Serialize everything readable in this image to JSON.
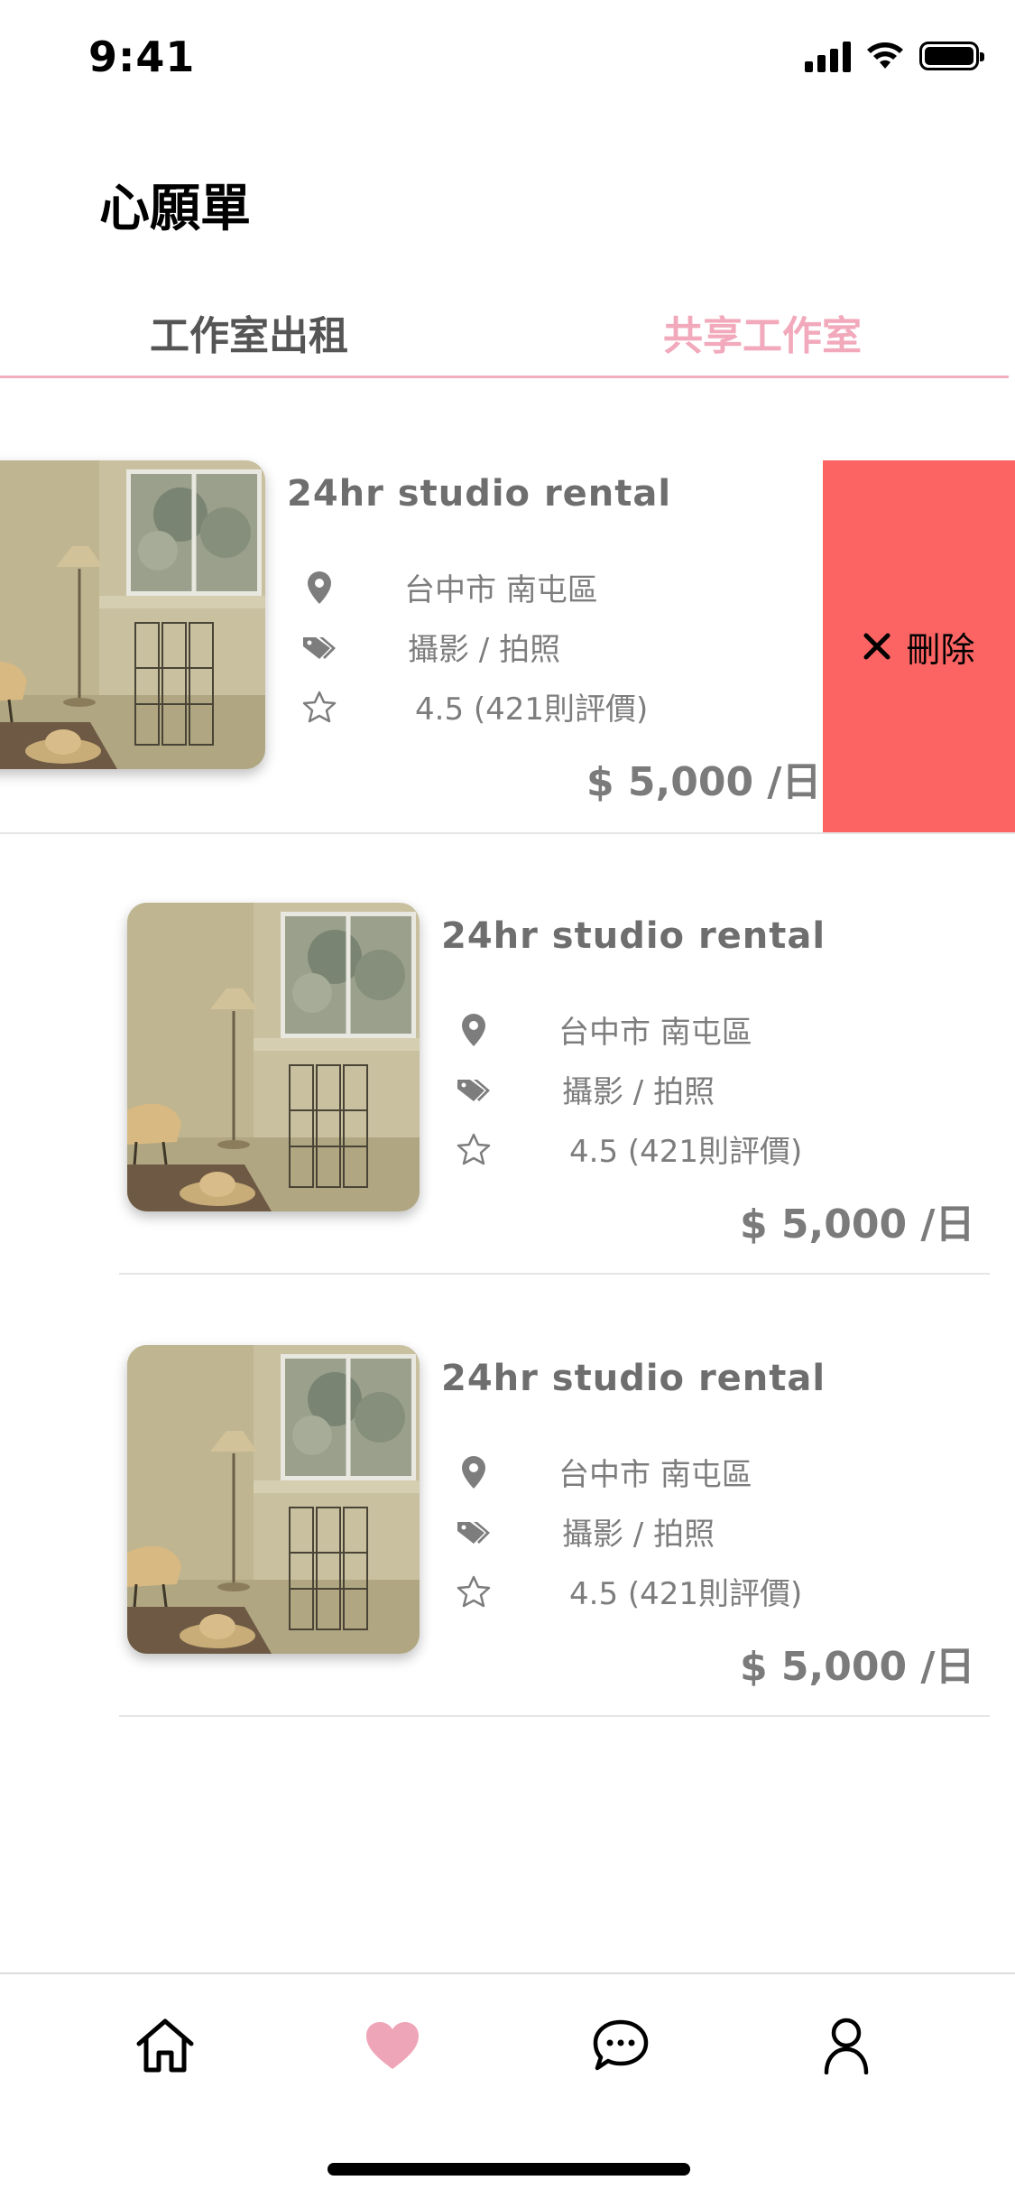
{
  "status_bar": {
    "time": "9:41"
  },
  "header": {
    "title": "心願單"
  },
  "tabs": [
    {
      "label": "工作室出租",
      "active": false
    },
    {
      "label": "共享工作室",
      "active": true
    }
  ],
  "listings": [
    {
      "title": "24hr studio rental",
      "location": "台中市 南屯區",
      "category": "攝影 / 拍照",
      "rating": "4.5 (421則評價)",
      "price": "$ 5,000 /日"
    },
    {
      "title": "24hr studio rental",
      "location": "台中市 南屯區",
      "category": "攝影 / 拍照",
      "rating": "4.5 (421則評價)",
      "price": "$ 5,000 /日"
    },
    {
      "title": "24hr studio rental",
      "location": "台中市 南屯區",
      "category": "攝影 / 拍照",
      "rating": "4.5 (421則評價)",
      "price": "$ 5,000 /日"
    }
  ],
  "swipe_action": {
    "label": "刪除",
    "icon": "close-icon",
    "color": "#fc6464"
  },
  "bottom_nav": [
    {
      "name": "home",
      "icon": "home-icon",
      "active": false
    },
    {
      "name": "wishlist",
      "icon": "heart-icon",
      "active": true
    },
    {
      "name": "messages",
      "icon": "chat-bubble-icon",
      "active": false
    },
    {
      "name": "profile",
      "icon": "user-icon",
      "active": false
    }
  ],
  "colors": {
    "accent": "#f1a9bb",
    "delete": "#fc6464",
    "text_muted": "#7d7d7d"
  }
}
